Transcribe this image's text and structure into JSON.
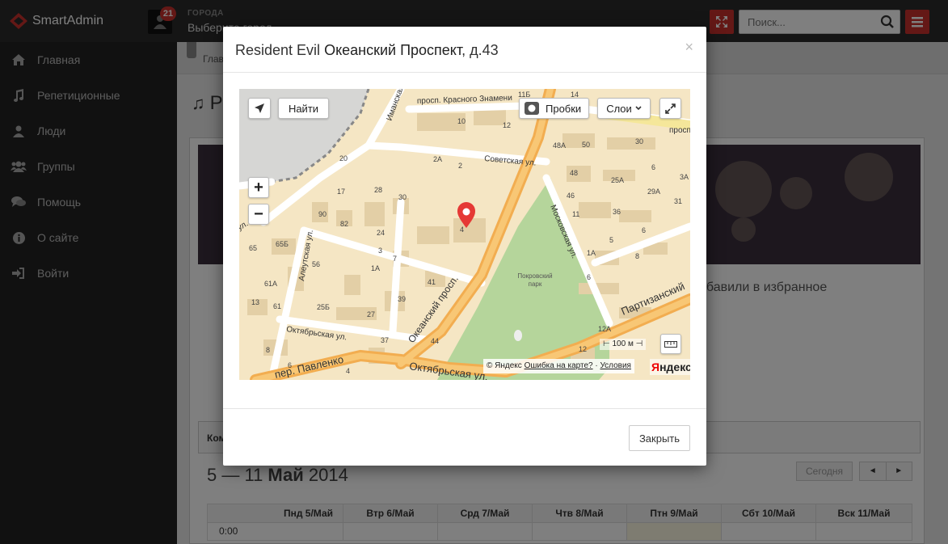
{
  "app": {
    "brand": "SmartAdmin",
    "notification_count": "21",
    "city_label": "ГОРОДА",
    "city_value": "Выберите город",
    "search_placeholder": "Поиск..."
  },
  "sidebar": {
    "items": [
      {
        "label": "Главная",
        "icon": "home-icon"
      },
      {
        "label": "Репетиционные",
        "icon": "music-icon"
      },
      {
        "label": "Люди",
        "icon": "user-icon"
      },
      {
        "label": "Группы",
        "icon": "group-icon"
      },
      {
        "label": "Помощь",
        "icon": "comments-icon"
      },
      {
        "label": "О сайте",
        "icon": "info-icon"
      },
      {
        "label": "Войти",
        "icon": "sign-in-icon"
      }
    ]
  },
  "content": {
    "breadcrumb": "Глав",
    "page_title": "Р",
    "favorite_text": "обавили в избранное",
    "tab_label": "Ком",
    "week_prefix": "5 — 11 ",
    "week_month": "Май",
    "week_year": " 2014",
    "today_button": "Сегодня",
    "prev_label": "◄",
    "next_label": "►",
    "calendar_days": [
      "Пнд 5/Май",
      "Втр 6/Май",
      "Срд 7/Май",
      "Чтв 8/Май",
      "Птн 9/Май",
      "Сбт 10/Май",
      "Вск 11/Май"
    ],
    "first_time": "0:00"
  },
  "modal": {
    "title_prefix": "Resident Evil",
    "title_street": "Океанский Проспект",
    "title_suffix": ", д.43",
    "close_symbol": "×",
    "close_button": "Закрыть"
  },
  "map": {
    "find_button": "Найти",
    "traffic_button": "Пробки",
    "layers_button": "Слои",
    "zoom_in": "+",
    "zoom_out": "−",
    "scale": "100 м",
    "copyright": "© Яндекс",
    "error_link": "Ошибка на карте?",
    "terms_link": "Условия",
    "logo_ya": "Я",
    "logo_rest": "ндекс",
    "park_name": "Покровский парк",
    "street_labels": [
      "просп. Красного Знамени",
      "Советская ул.",
      "Московская ул.",
      "Океанский просп.",
      "Октябрьская ул.",
      "Октябрьская ул.",
      "пер. Павленко",
      "Алеутская ул.",
      "Партизанский",
      "Иманская",
      "ул.",
      "просп"
    ],
    "house_numbers": [
      "11Б",
      "10",
      "12",
      "14",
      "48А",
      "50",
      "30",
      "48",
      "25А",
      "46",
      "29А",
      "36",
      "31",
      "11",
      "5",
      "1А",
      "8",
      "6",
      "4",
      "12А",
      "12",
      "2А",
      "2",
      "28",
      "30",
      "17",
      "90",
      "82",
      "24",
      "65Б",
      "65",
      "56",
      "3",
      "7",
      "1А",
      "41",
      "61А",
      "13",
      "61",
      "25Б",
      "27",
      "39",
      "37",
      "44",
      "8",
      "6",
      "4",
      "20",
      "6",
      "3А"
    ],
    "colors": {
      "land": "#f5e6c4",
      "road": "#ffffff",
      "major_road": "#f5a623",
      "park": "#b5d59b",
      "building": "#e3cfa6",
      "water": "#d4d4d4"
    }
  }
}
